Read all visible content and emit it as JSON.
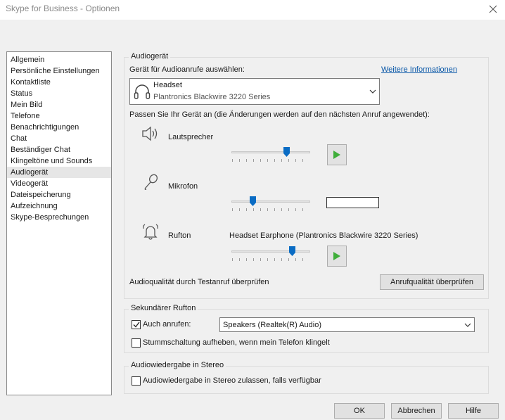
{
  "window": {
    "title": "Skype for Business - Optionen"
  },
  "nav": {
    "items": [
      "Allgemein",
      "Persönliche Einstellungen",
      "Kontaktliste",
      "Status",
      "Mein Bild",
      "Telefone",
      "Benachrichtigungen",
      "Chat",
      "Beständiger Chat",
      "Klingeltöne und Sounds",
      "Audiogerät",
      "Videogerät",
      "Dateispeicherung",
      "Aufzeichnung",
      "Skype-Besprechungen"
    ],
    "selected": "Audiogerät"
  },
  "audio": {
    "group_label": "Audiogerät",
    "select_label": "Gerät für Audioanrufe auswählen:",
    "more_info_link": "Weitere Informationen",
    "device_name": "Headset",
    "device_model": "Plantronics Blackwire 3220 Series",
    "customize_label": "Passen Sie Ihr Gerät an (die Änderungen werden auf den nächsten Anruf angewendet):",
    "speaker_label": "Lautsprecher",
    "speaker_level": 0.72,
    "mic_label": "Mikrofon",
    "mic_level": 0.25,
    "ringer_label": "Rufton",
    "ringer_device": "Headset Earphone (Plantronics Blackwire 3220 Series)",
    "ringer_level": 0.8,
    "test_label": "Audioqualität durch Testanruf überprüfen",
    "test_button": "Anrufqualität überprüfen"
  },
  "secondary": {
    "group_label": "Sekundärer Rufton",
    "also_ring_label": "Auch anrufen:",
    "also_ring_checked": true,
    "also_ring_device": "Speakers (Realtek(R) Audio)",
    "unmute_label": "Stummschaltung aufheben, wenn mein Telefon klingelt",
    "unmute_checked": false
  },
  "stereo": {
    "group_label": "Audiowiedergabe in Stereo",
    "allow_label": "Audiowiedergabe in Stereo zulassen, falls verfügbar",
    "allow_checked": false
  },
  "buttons": {
    "ok": "OK",
    "cancel": "Abbrechen",
    "help": "Hilfe"
  },
  "colors": {
    "accent": "#0a6cc4",
    "play_green": "#3fae3a",
    "link": "#0a58a8"
  }
}
